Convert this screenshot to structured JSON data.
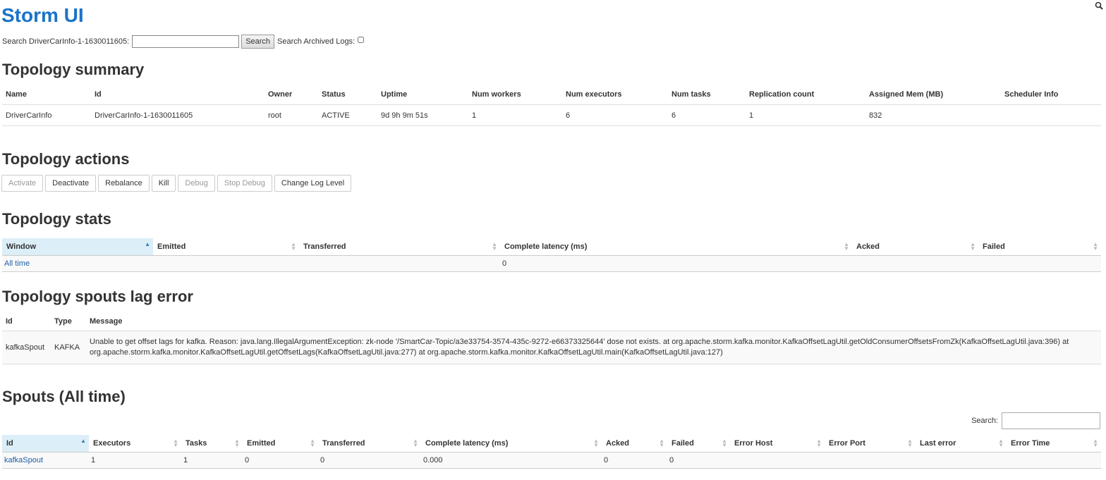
{
  "app_title": "Storm UI",
  "search": {
    "label": "Search DriverCarInfo-1-1630011605:",
    "value": "",
    "button": "Search",
    "archived_label": "Search Archived Logs:"
  },
  "summary": {
    "heading": "Topology summary",
    "columns": [
      "Name",
      "Id",
      "Owner",
      "Status",
      "Uptime",
      "Num workers",
      "Num executors",
      "Num tasks",
      "Replication count",
      "Assigned Mem (MB)",
      "Scheduler Info"
    ],
    "row": [
      "DriverCarInfo",
      "DriverCarInfo-1-1630011605",
      "root",
      "ACTIVE",
      "9d 9h 9m 51s",
      "1",
      "6",
      "6",
      "1",
      "832",
      ""
    ]
  },
  "actions": {
    "heading": "Topology actions",
    "buttons": [
      {
        "label": "Activate",
        "enabled": false
      },
      {
        "label": "Deactivate",
        "enabled": true
      },
      {
        "label": "Rebalance",
        "enabled": true
      },
      {
        "label": "Kill",
        "enabled": true
      },
      {
        "label": "Debug",
        "enabled": false
      },
      {
        "label": "Stop Debug",
        "enabled": false
      },
      {
        "label": "Change Log Level",
        "enabled": true
      }
    ]
  },
  "stats": {
    "heading": "Topology stats",
    "columns": [
      "Window",
      "Emitted",
      "Transferred",
      "Complete latency (ms)",
      "Acked",
      "Failed"
    ],
    "row": [
      "All time",
      "",
      "",
      "0",
      "",
      ""
    ]
  },
  "lag": {
    "heading": "Topology spouts lag error",
    "columns": [
      "Id",
      "Type",
      "Message"
    ],
    "row": [
      "kafkaSpout",
      "KAFKA",
      "Unable to get offset lags for kafka. Reason: java.lang.IllegalArgumentException: zk-node '/SmartCar-Topic/a3e33754-3574-435c-9272-e66373325644' dose not exists. at org.apache.storm.kafka.monitor.KafkaOffsetLagUtil.getOldConsumerOffsetsFromZk(KafkaOffsetLagUtil.java:396) at org.apache.storm.kafka.monitor.KafkaOffsetLagUtil.getOffsetLags(KafkaOffsetLagUtil.java:277) at org.apache.storm.kafka.monitor.KafkaOffsetLagUtil.main(KafkaOffsetLagUtil.java:127)"
    ]
  },
  "spouts": {
    "heading": "Spouts (All time)",
    "search_label": "Search:",
    "columns": [
      "Id",
      "Executors",
      "Tasks",
      "Emitted",
      "Transferred",
      "Complete latency (ms)",
      "Acked",
      "Failed",
      "Error Host",
      "Error Port",
      "Last error",
      "Error Time"
    ],
    "row": [
      "kafkaSpout",
      "1",
      "1",
      "0",
      "0",
      "0.000",
      "0",
      "0",
      "",
      "",
      "",
      ""
    ]
  },
  "icons": {
    "search": "search-icon",
    "sort": "sort-arrows-icon"
  },
  "colors": {
    "title": "#1a73c9",
    "link": "#1f5fa5",
    "sorted_header": "#dceef8"
  }
}
